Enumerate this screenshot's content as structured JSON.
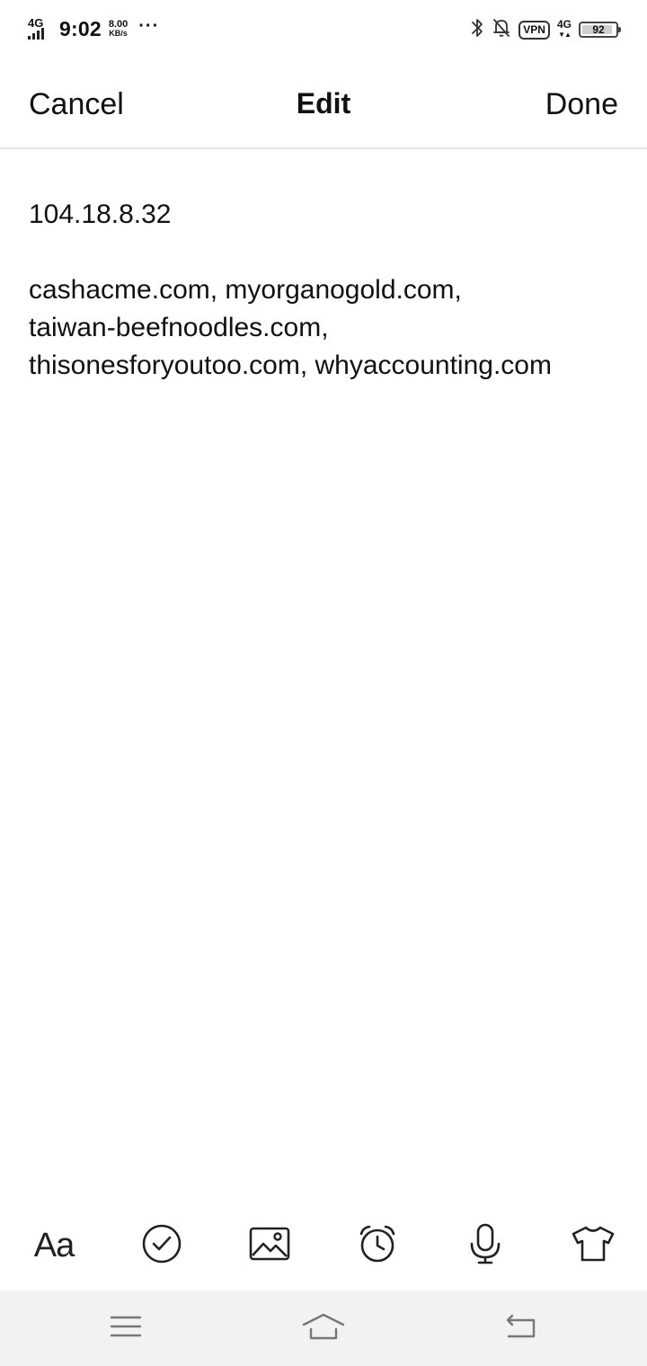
{
  "status_bar": {
    "network_left": "4G",
    "time": "9:02",
    "speed_value": "8.00",
    "speed_unit": "KB/s",
    "more": "···",
    "vpn": "VPN",
    "network_right": "4G",
    "battery_level": "92"
  },
  "header": {
    "cancel_label": "Cancel",
    "title": "Edit",
    "done_label": "Done"
  },
  "note": {
    "lines": [
      "104.18.8.32",
      "",
      "cashacme.com, myorganogold.com,",
      "taiwan-beefnoodles.com,",
      "thisonesforyoutoo.com, whyaccounting.com"
    ]
  },
  "toolbar": {
    "font_label": "Aa",
    "items": [
      "font-icon",
      "checklist-icon",
      "image-icon",
      "alarm-clock-icon",
      "microphone-icon",
      "shirt-icon"
    ]
  },
  "nav_bar": {
    "items": [
      "menu-icon",
      "home-icon",
      "back-icon"
    ]
  },
  "colors": {
    "text": "#111111",
    "icon": "#222222",
    "divider": "#e6e6e6",
    "nav_background": "#f2f2f2"
  }
}
